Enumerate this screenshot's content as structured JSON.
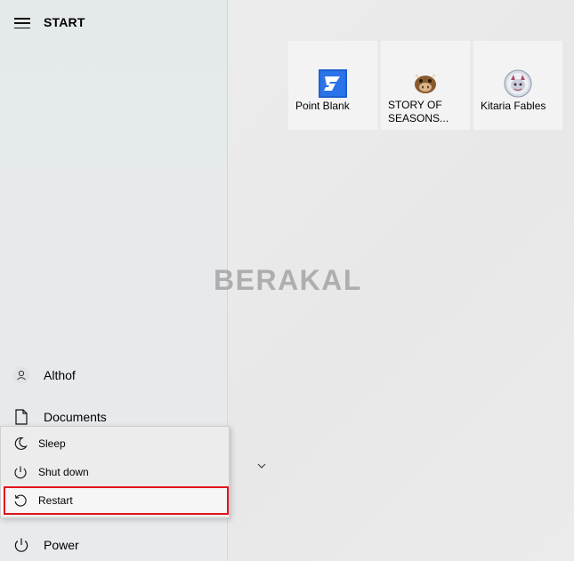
{
  "header": {
    "title": "START"
  },
  "tiles": [
    {
      "label": "Point Blank",
      "icon": "point-blank-icon"
    },
    {
      "label": "STORY OF SEASONS...",
      "line1": "STORY OF",
      "line2": "SEASONS...",
      "icon": "story-of-seasons-icon"
    },
    {
      "label": "Kitaria Fables",
      "icon": "kitaria-fables-icon"
    }
  ],
  "nav": {
    "user": "Althof",
    "documents": "Documents",
    "power": "Power"
  },
  "power_menu": {
    "sleep": "Sleep",
    "shutdown": "Shut down",
    "restart": "Restart"
  },
  "watermark": "BERAKAL",
  "colors": {
    "highlight": "#e0141c",
    "tile_bg": "#f3f3f3",
    "point_blank_blue": "#1a5fd0"
  }
}
